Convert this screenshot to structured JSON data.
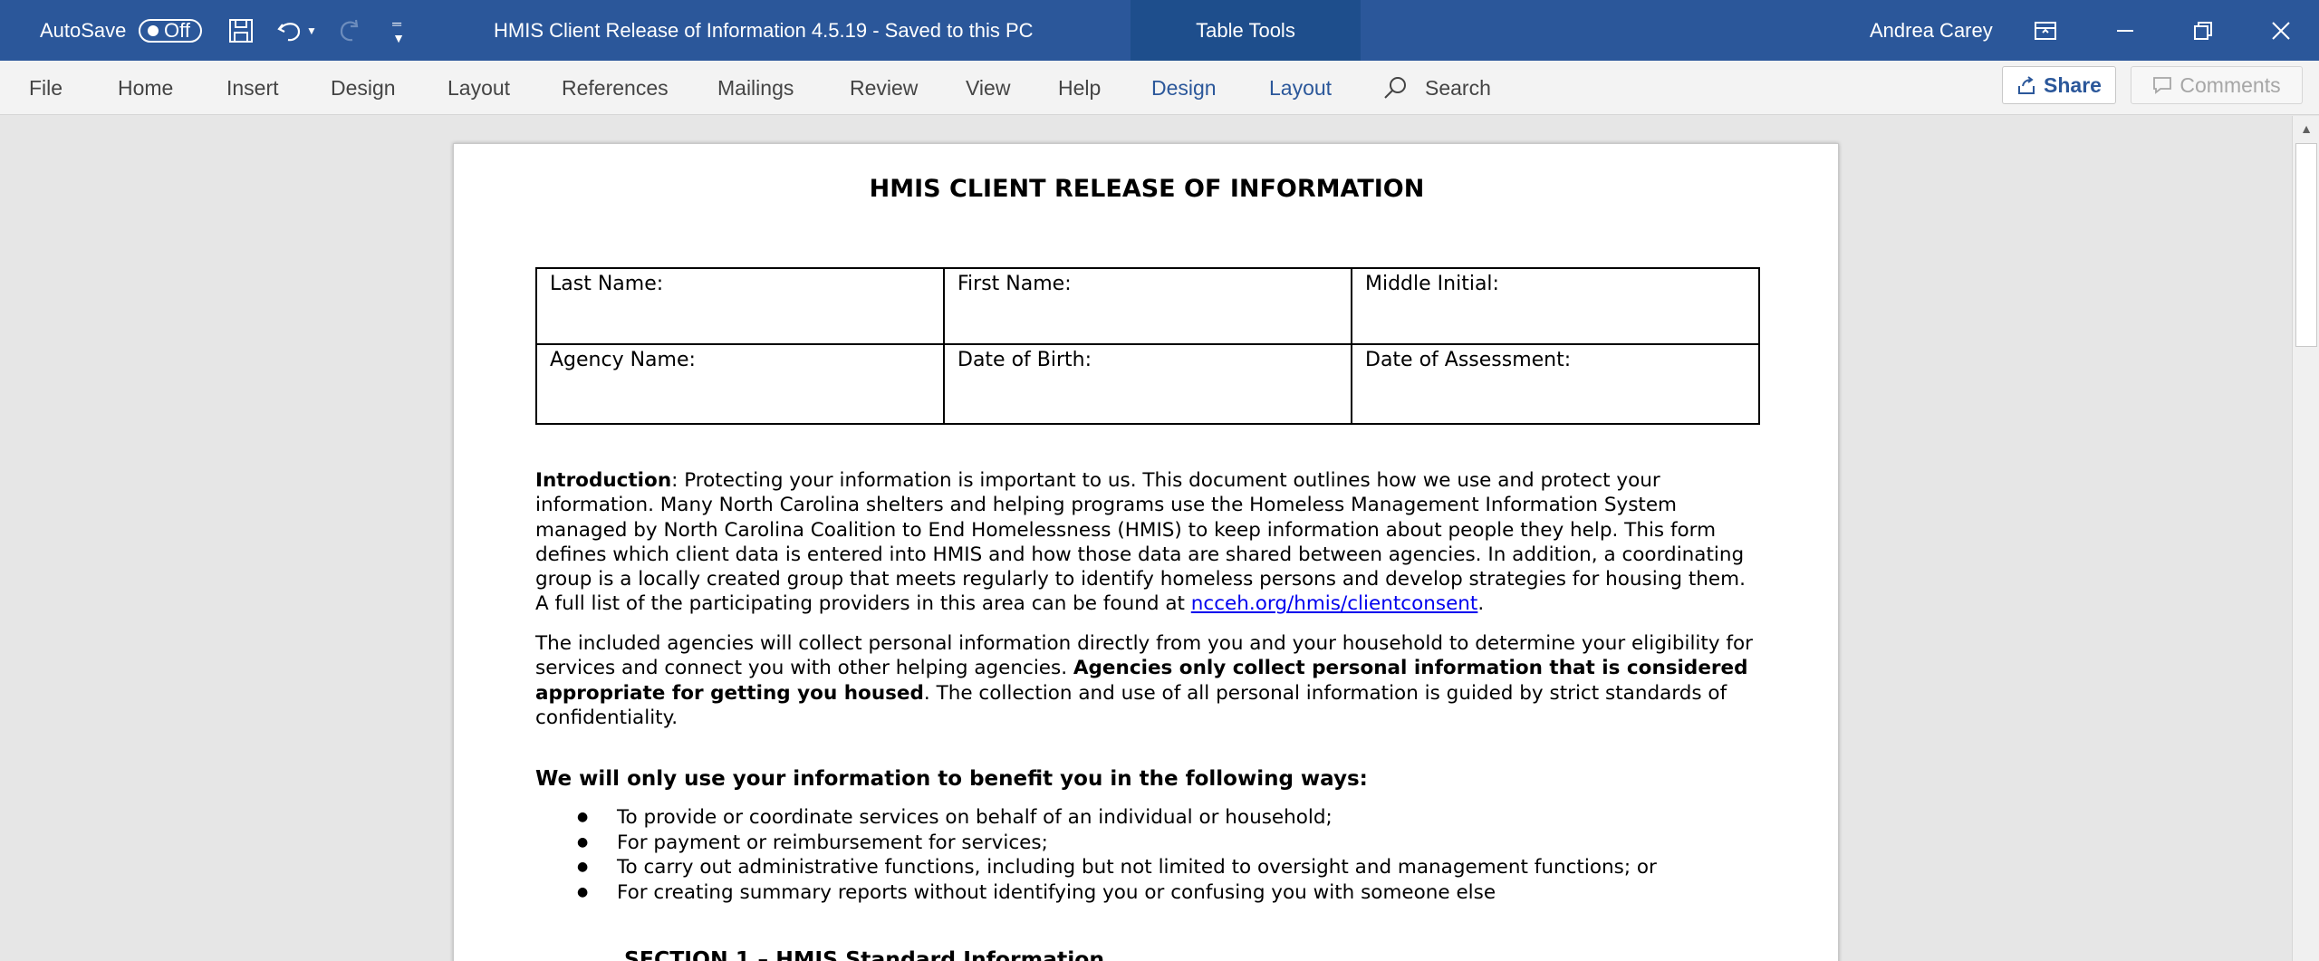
{
  "titlebar": {
    "autosave_label": "AutoSave",
    "autosave_state": "Off",
    "document_title": "HMIS Client Release of Information 4.5.19  -  Saved to this PC",
    "table_tools": "Table Tools",
    "user_name": "Andrea Carey",
    "color": "#2b579a"
  },
  "ribbon": {
    "tabs": [
      "File",
      "Home",
      "Insert",
      "Design",
      "Layout",
      "References",
      "Mailings",
      "Review",
      "View",
      "Help",
      "Design",
      "Layout"
    ],
    "search": "Search",
    "share": "Share",
    "comments": "Comments"
  },
  "document": {
    "heading": "HMIS CLIENT RELEASE OF INFORMATION",
    "form": {
      "last_name": "Last Name:",
      "first_name": "First Name:",
      "middle_initial": "Middle Initial:",
      "agency_name": "Agency Name:",
      "date_of_birth": "Date of Birth:",
      "date_of_assessment": "Date of Assessment:"
    },
    "intro_label": "Introduction",
    "intro_text": ":  Protecting your information is important to us. This document outlines how we use and protect your information. Many North Carolina shelters and helping programs use the Homeless Management Information System managed by North Carolina Coalition to End Homelessness (HMIS) to keep information about people they help. This form defines which client data is entered into HMIS and how those data are shared between agencies. In addition, a coordinating group is a locally created group that meets regularly to identify homeless persons and develop strategies for housing them. A full list of the participating providers in this area can be found at ",
    "intro_link": "ncceh.org/hmis/clientconsent",
    "intro_end": ".",
    "p2_start": "The included agencies will collect personal information directly from you and your household to determine your eligibility for services and connect you with other helping agencies.  ",
    "p2_bold": "Agencies only collect personal information that is considered appropriate for getting you housed",
    "p2_end": ". The collection and use of all personal information is guided by strict standards of confidentiality.",
    "ways_heading": "We will only use your information to benefit you in the following ways:",
    "ways": [
      "To provide or coordinate services on behalf of an individual or household;",
      "For payment or reimbursement for services;",
      "To carry out administrative functions, including but not limited to oversight and management functions; or",
      "For creating summary reports without identifying you or confusing you with someone else"
    ],
    "section1": "SECTION 1 – HMIS Standard Information"
  }
}
